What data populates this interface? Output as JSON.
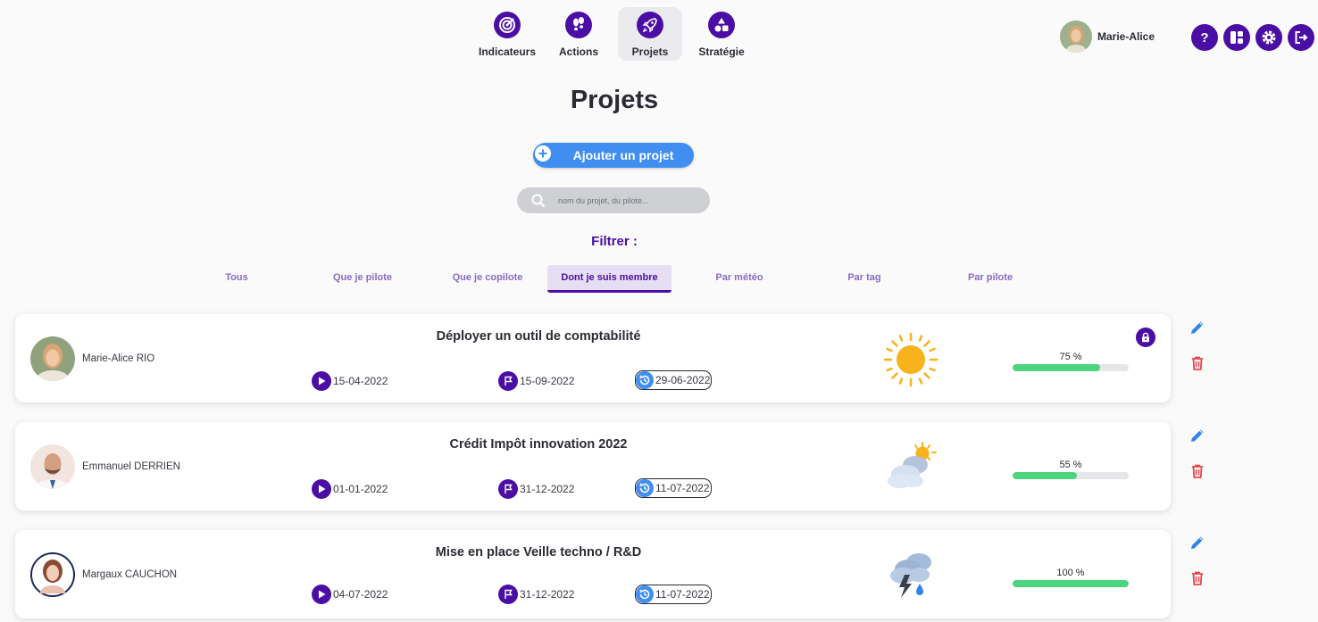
{
  "nav": {
    "items": [
      {
        "label": "Indicateurs",
        "icon": "target-icon"
      },
      {
        "label": "Actions",
        "icon": "footsteps-icon"
      },
      {
        "label": "Projets",
        "icon": "rocket-icon",
        "active": true
      },
      {
        "label": "Stratégie",
        "icon": "shapes-icon"
      }
    ]
  },
  "user": {
    "name": "Marie-Alice"
  },
  "top_actions": [
    "help-icon",
    "dashboard-icon",
    "settings-icon",
    "logout-icon"
  ],
  "page": {
    "title": "Projets",
    "add_button": "Ajouter un projet",
    "search_placeholder": "nom du projet, du pilote...",
    "filter_label": "Filtrer :"
  },
  "tabs": [
    {
      "label": "Tous"
    },
    {
      "label": "Que je pilote"
    },
    {
      "label": "Que je copilote"
    },
    {
      "label": "Dont je suis membre",
      "active": true
    },
    {
      "label": "Par météo"
    },
    {
      "label": "Par tag"
    },
    {
      "label": "Par pilote"
    }
  ],
  "projects": [
    {
      "pilot": "Marie-Alice RIO",
      "title": "Déployer un outil de comptabilité",
      "start": "15-04-2022",
      "end": "15-09-2022",
      "updated": "29-06-2022",
      "weather": "sun",
      "progress_label": "75 %",
      "progress": 75,
      "locked": true
    },
    {
      "pilot": "Emmanuel DERRIEN",
      "title": "Crédit Impôt innovation 2022",
      "start": "01-01-2022",
      "end": "31-12-2022",
      "updated": "11-07-2022",
      "weather": "partly-cloudy",
      "progress_label": "55 %",
      "progress": 55,
      "locked": false
    },
    {
      "pilot": "Margaux CAUCHON",
      "title": "Mise en place Veille techno / R&D",
      "start": "04-07-2022",
      "end": "31-12-2022",
      "updated": "11-07-2022",
      "weather": "storm",
      "progress_label": "100 %",
      "progress": 100,
      "locked": false
    }
  ],
  "colors": {
    "primary": "#4b0ea4",
    "accent_blue": "#3f8ef0",
    "progress_green": "#4ed47f",
    "delete_red": "#e5484d"
  }
}
